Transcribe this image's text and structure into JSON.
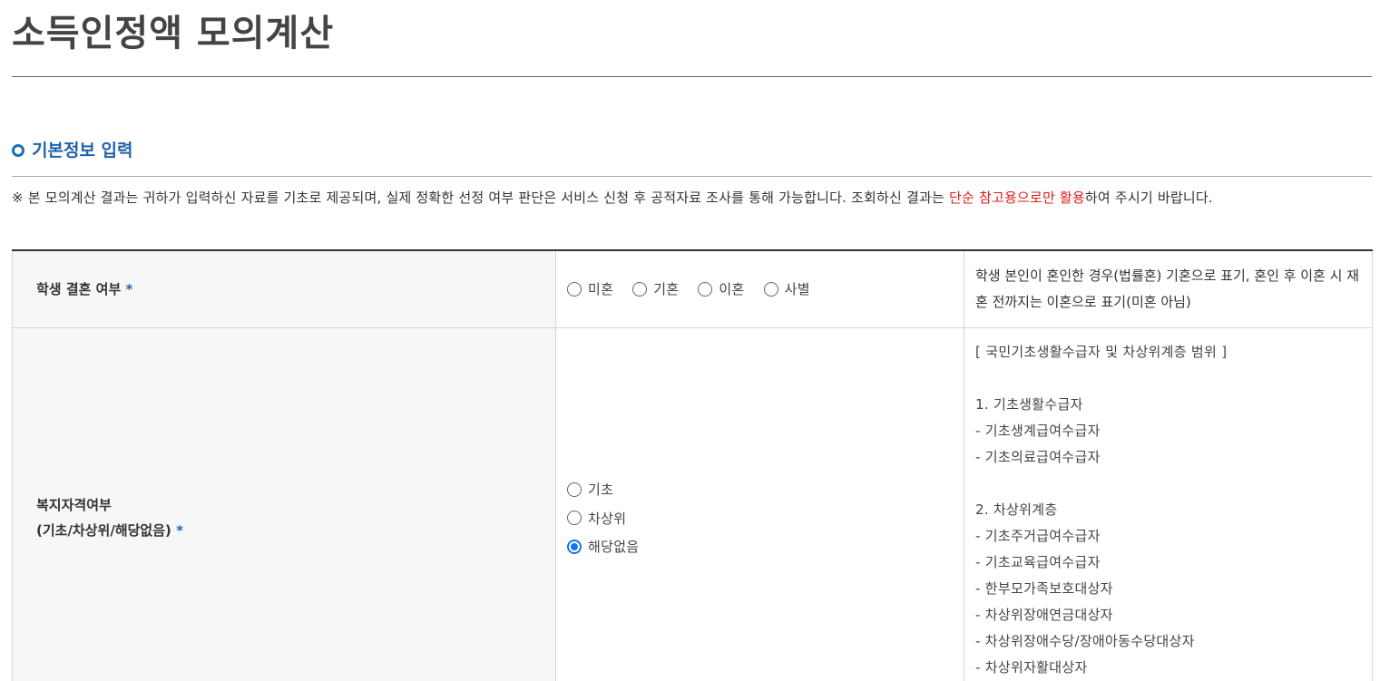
{
  "page": {
    "title": "소득인정액 모의계산"
  },
  "section": {
    "heading": "기본정보 입력"
  },
  "notice": {
    "prefix": "※ 본 모의계산 결과는 귀하가 입력하신 자료를 기초로 제공되며, 실제 정확한 선정 여부 판단은 서비스 신청 후 공적자료 조사를 통해 가능합니다. 조회하신 결과는 ",
    "highlight": "단순 참고용으로만 활용",
    "suffix": "하여 주시기 바랍니다."
  },
  "marriage": {
    "label": "학생 결혼 여부",
    "required_mark": "*",
    "options": [
      "미혼",
      "기혼",
      "이혼",
      "사별"
    ],
    "selected": null,
    "info": "학생 본인이 혼인한 경우(법률혼) 기혼으로 표기, 혼인 후 이혼 시 재혼 전까지는 이혼으로 표기(미혼 아님)"
  },
  "welfare": {
    "label_line1": "복지자격여부",
    "label_line2": "(기초/차상위/해당없음)",
    "required_mark": "*",
    "options": [
      "기초",
      "차상위",
      "해당없음"
    ],
    "selected": "해당없음",
    "info_title": "[ 국민기초생활수급자 및 차상위계층 범위 ]",
    "group1_title": "1. 기초생활수급자",
    "group1_items": [
      "-  기초생계급여수급자",
      "-  기초의료급여수급자"
    ],
    "group2_title": "2. 차상위계층",
    "group2_items": [
      "-  기초주거급여수급자",
      "-  기초교육급여수급자",
      "-  한부모가족보호대상자",
      "-  차상위장애연금대상자",
      "-  차상위장애수당/장애아동수당대상자",
      "-  차상위자활대상자"
    ]
  },
  "colors": {
    "accent": "#1f62a8",
    "highlight": "#e21b1b",
    "radio_checked": "#1a73e8"
  }
}
